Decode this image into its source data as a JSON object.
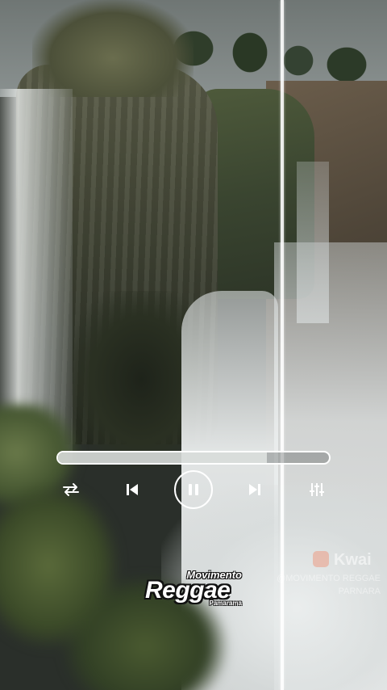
{
  "player": {
    "progress": 0.77,
    "controls": {
      "shuffle_icon": "repeat-icon",
      "prev_icon": "skip-previous-icon",
      "pause_icon": "pause-icon",
      "next_icon": "skip-next-icon",
      "eq_icon": "equalizer-icon"
    }
  },
  "brand": {
    "line1": "Movimento",
    "main": "Reggae",
    "sub": "Pamarama"
  },
  "watermark": {
    "logo_icon": "kwai-logo-icon",
    "name": "Kwai",
    "handle": "@MOVIMENTO REGGAE",
    "handle2": "PARNARA"
  }
}
